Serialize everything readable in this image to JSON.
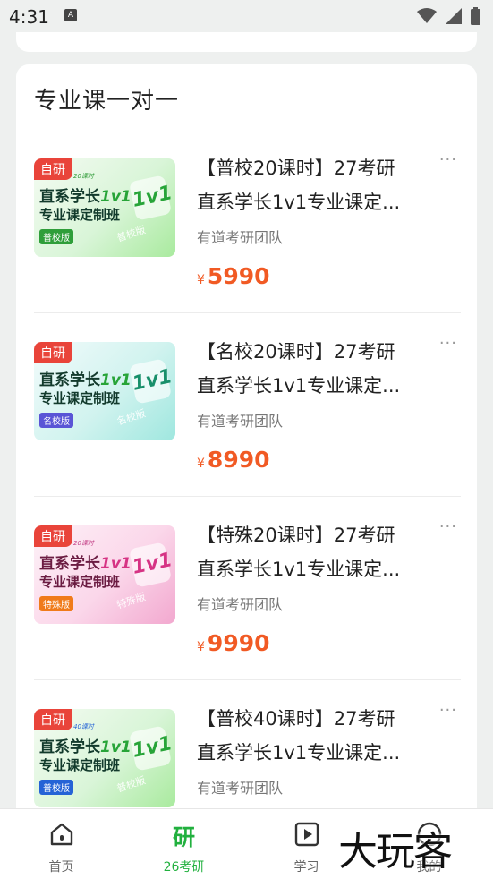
{
  "status_bar": {
    "time": "4:31",
    "notification_glyph": "A"
  },
  "section": {
    "title": "专业课一对一"
  },
  "thumb_text": {
    "tag": "自研",
    "minitag_20": "20课时",
    "minitag_40": "40课时",
    "line1_a": "直系学长",
    "line1_b": "1v1",
    "line2": "专业课定制班",
    "mark": "1v1"
  },
  "courses": [
    {
      "title_line1": "【普校20课时】27考研",
      "title_line2": "直系学长1v1专业课定...",
      "team": "有道考研团队",
      "currency": "¥",
      "price": "5990",
      "badge": "普校版",
      "theme": "green"
    },
    {
      "title_line1": "【名校20课时】27考研",
      "title_line2": "直系学长1v1专业课定...",
      "team": "有道考研团队",
      "currency": "¥",
      "price": "8990",
      "badge": "名校版",
      "theme": "cyan"
    },
    {
      "title_line1": "【特殊20课时】27考研",
      "title_line2": "直系学长1v1专业课定...",
      "team": "有道考研团队",
      "currency": "¥",
      "price": "9990",
      "badge": "特殊版",
      "theme": "pink"
    },
    {
      "title_line1": "【普校40课时】27考研",
      "title_line2": "直系学长1v1专业课定...",
      "team": "有道考研团队",
      "currency": "¥",
      "price": "",
      "badge": "普校版",
      "theme": "green"
    }
  ],
  "more_glyph": "···",
  "tabbar": {
    "tabs": [
      {
        "label": "首页",
        "icon": "home-icon"
      },
      {
        "label": "26考研",
        "icon_text": "研",
        "active": true
      },
      {
        "label": "学习",
        "icon": "play-icon"
      },
      {
        "label": "我的",
        "icon": "profile-icon"
      }
    ]
  },
  "overlay_logo": "大玩客",
  "colors": {
    "accent": "#21b03e",
    "price": "#f15a24",
    "tag": "#e9443a"
  }
}
